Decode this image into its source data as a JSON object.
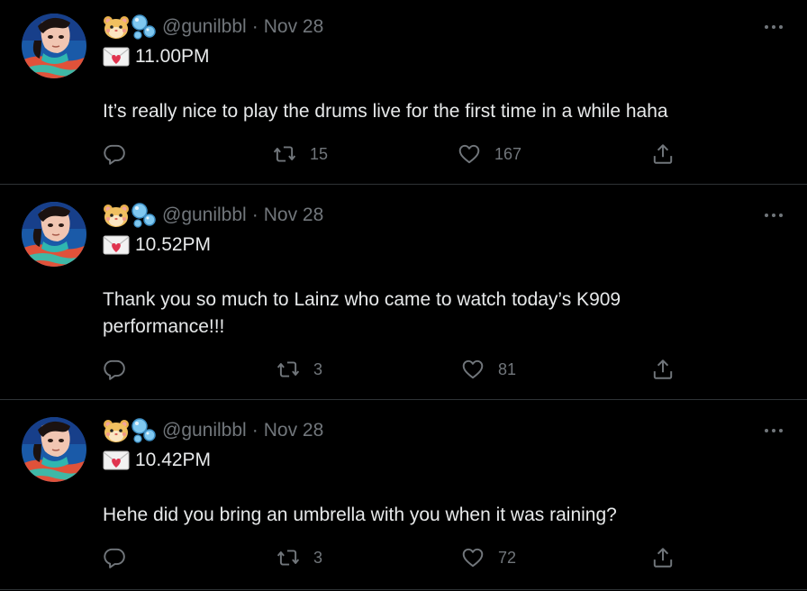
{
  "tweets": [
    {
      "handle": "@gunilbbl",
      "sep": "·",
      "date": "Nov 28",
      "time": "11.00PM",
      "text": "It’s really nice to play the drums live for the first time in a while haha",
      "retweets": "15",
      "likes": "167"
    },
    {
      "handle": "@gunilbbl",
      "sep": "·",
      "date": "Nov 28",
      "time": "10.52PM",
      "text": "Thank you so much to Lainz who came to watch today’s K909 performance!!!",
      "retweets": "3",
      "likes": "81"
    },
    {
      "handle": "@gunilbbl",
      "sep": "·",
      "date": "Nov 28",
      "time": "10.42PM",
      "text": "Hehe did you bring an umbrella with you when it was raining?",
      "retweets": "3",
      "likes": "72"
    }
  ],
  "icons": {
    "name_emoji_1": "hamster-face-icon",
    "name_emoji_2": "bubbles-icon",
    "time_emoji": "love-letter-icon",
    "reply": "reply-icon",
    "retweet": "retweet-icon",
    "like": "heart-icon",
    "share": "share-icon",
    "more": "more-dots-icon"
  },
  "colors": {
    "background": "#000000",
    "text": "#e7e9ea",
    "secondary": "#71767b",
    "divider": "#2f3336"
  }
}
